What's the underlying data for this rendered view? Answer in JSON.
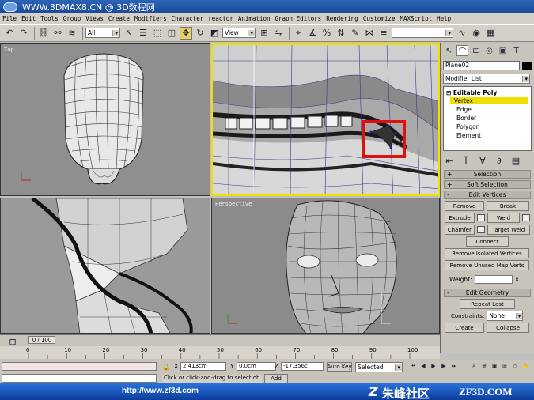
{
  "titlebar": {
    "text": "WWW.3DMAX8.CN @ 3D数程网"
  },
  "menu": [
    "File",
    "Edit",
    "Tools",
    "Group",
    "Views",
    "Create",
    "Modifiers",
    "Character",
    "reactor",
    "Animation",
    "Graph Editors",
    "Rendering",
    "Customize",
    "MAXScript",
    "Help"
  ],
  "toolbar": {
    "filter_value": "All",
    "view_value": "View"
  },
  "viewports": {
    "top": "Top",
    "front": "",
    "left": "",
    "perspective": "Perspective"
  },
  "panel": {
    "object_name": "Plane02",
    "modifier_list": "Modifier List",
    "stack": {
      "root": "Editable Poly",
      "items": [
        "Vertex",
        "Edge",
        "Border",
        "Polygon",
        "Element"
      ],
      "selected": "Vertex"
    },
    "rollouts": {
      "selection": "Selection",
      "soft_selection": "Soft Selection",
      "edit_vertices": "Edit Vertices",
      "edit_geometry": "Edit Geometry"
    },
    "buttons": {
      "remove": "Remove",
      "break": "Break",
      "extrude": "Extrude",
      "weld": "Weld",
      "chamfer": "Chamfer",
      "target_weld": "Target Weld",
      "connect": "Connect",
      "remove_isolated": "Remove Isolated Vertices",
      "remove_unused": "Remove Unused Map Verts",
      "weight_label": "Weight:",
      "repeat_last": "Repeat Last",
      "constraints_label": "Constraints:",
      "constraints_value": "None",
      "create": "Create",
      "collapse": "Collapse"
    }
  },
  "timeline": {
    "slider": "0 / 100",
    "ticks": [
      "0",
      "10",
      "20",
      "30",
      "40",
      "50",
      "60",
      "70",
      "80",
      "90",
      "100"
    ]
  },
  "status": {
    "x_label": "X",
    "x_value": "2.413cm",
    "y_label": "Y",
    "y_value": "0.0cm",
    "z_label": "Z",
    "z_value": "-17.356c",
    "auto_key": "Auto Key",
    "key_mode": "Selected",
    "prompt": "Click or click-and-drag to select ob",
    "add_time_tag": "Add"
  },
  "footer": {
    "url": "http://www.zf3d.com",
    "brand_cn": "朱峰社区",
    "brand_en": "ZF3D.COM",
    "brand_mark": "Z"
  },
  "colors": {
    "active_border": "#f0e000",
    "highlight_box": "#e01010",
    "selected_stack": "#f0e000",
    "footer_blue": "#1450b8"
  }
}
